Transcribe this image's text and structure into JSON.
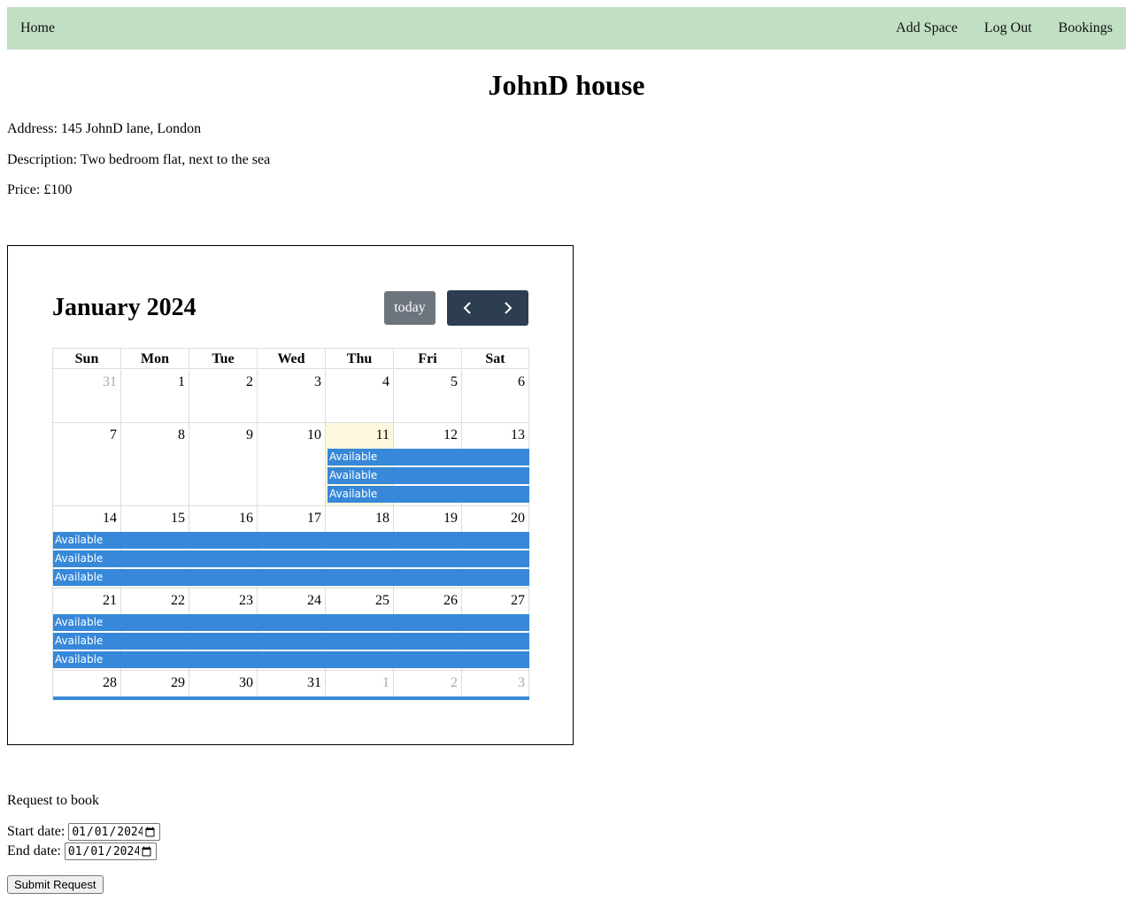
{
  "nav": {
    "home": "Home",
    "add_space": "Add Space",
    "log_out": "Log Out",
    "bookings": "Bookings"
  },
  "space": {
    "title": "JohnD house",
    "address": "Address: 145 JohnD lane, London",
    "description": "Description: Two bedroom flat, next to the sea",
    "price": "Price: £100"
  },
  "calendar": {
    "title": "January 2024",
    "today_label": "today",
    "prev_icon": "chevron-left-icon",
    "next_icon": "chevron-right-icon",
    "weekdays": [
      "Sun",
      "Mon",
      "Tue",
      "Wed",
      "Thu",
      "Fri",
      "Sat"
    ],
    "weeks": [
      [
        "31",
        "1",
        "2",
        "3",
        "4",
        "5",
        "6"
      ],
      [
        "7",
        "8",
        "9",
        "10",
        "11",
        "12",
        "13"
      ],
      [
        "14",
        "15",
        "16",
        "17",
        "18",
        "19",
        "20"
      ],
      [
        "21",
        "22",
        "23",
        "24",
        "25",
        "26",
        "27"
      ],
      [
        "28",
        "29",
        "30",
        "31",
        "1",
        "2",
        "3"
      ]
    ],
    "event_label": "Available",
    "today_date": "11",
    "colors": {
      "event": "#3788d8",
      "today_bg": "#fef8df",
      "today_button": "#6c757d",
      "nav_buttons": "#2c3e50",
      "navbar": "#c1dfc3"
    }
  },
  "booking": {
    "heading": "Request to book",
    "start_label": "Start date:",
    "start_value": "2024-01-01",
    "end_label": "End date:",
    "end_value": "2024-01-01",
    "submit_label": "Submit Request"
  }
}
